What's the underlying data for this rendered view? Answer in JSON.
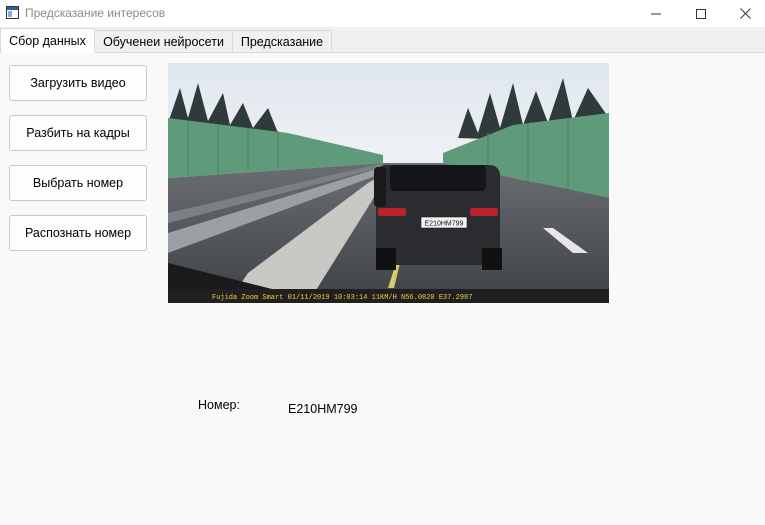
{
  "window": {
    "title": "Предсказание интересов",
    "icons": {
      "app": "app-window-icon",
      "minimize": "minimize-icon",
      "maximize": "maximize-icon",
      "close": "close-icon"
    }
  },
  "tabs": [
    {
      "label": "Сбор данных",
      "active": true
    },
    {
      "label": "Обученеи нейросети",
      "active": false
    },
    {
      "label": "Предсказание",
      "active": false
    }
  ],
  "buttons": {
    "load_video": "Загрузить видео",
    "split_frames": "Разбить на кадры",
    "select_number": "Выбрать номер",
    "recognize_number": "Распознать номер"
  },
  "frame": {
    "overlay_text": "Fujida Zoom Smart 01/11/2019 10:03:14   11KM/H N56.0820 E37.2987",
    "plate_text": "E210HM799"
  },
  "result": {
    "label": "Номер:",
    "value": "E210HM799"
  },
  "colors": {
    "window_bg": "#f0f0f0",
    "pane_bg": "#f9f9f9",
    "overlay_text": "#e8d23c",
    "fence": "#5f9a7a"
  }
}
